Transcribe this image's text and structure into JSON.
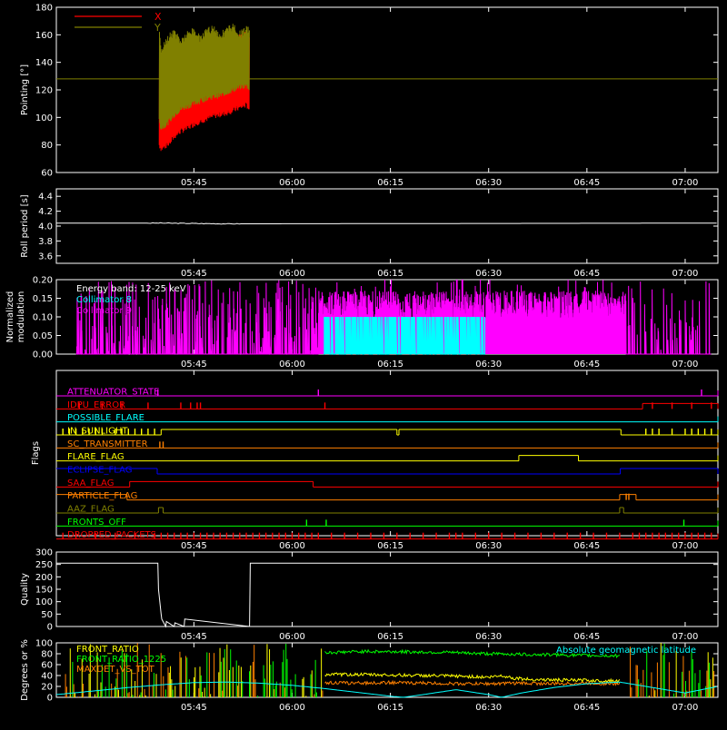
{
  "time_axis": {
    "ticks": [
      "05:45",
      "06:00",
      "06:15",
      "06:30",
      "06:45",
      "07:00"
    ],
    "tick_times_min": [
      345,
      360,
      375,
      390,
      405,
      420
    ],
    "range_min": [
      324,
      425
    ]
  },
  "chart_data": [
    {
      "id": "pointing",
      "type": "line",
      "ylabel": "Pointing [°]",
      "ylim": [
        60,
        180
      ],
      "yticks": [
        "60",
        "80",
        "100",
        "120",
        "140",
        "160",
        "180"
      ],
      "ytick_values": [
        60,
        80,
        100,
        120,
        140,
        160,
        180
      ],
      "legend": [
        {
          "name": "X",
          "color": "#ff0000"
        },
        {
          "name": "Y",
          "color": "#808000"
        }
      ],
      "legend_position": "top-left",
      "reference_line": {
        "value": 128,
        "color": "#808000"
      },
      "series": [
        {
          "name": "X",
          "color": "#ff0000",
          "x_min": [
            339.7,
            340,
            341,
            342,
            343,
            344,
            345,
            346,
            347,
            348,
            349,
            350,
            351,
            352,
            353,
            353.5
          ],
          "y_min": [
            78,
            75,
            78,
            84,
            88,
            90,
            93,
            95,
            97,
            99,
            100,
            101,
            103,
            105,
            107,
            104
          ],
          "y_max": [
            150,
            148,
            150,
            152,
            153,
            150,
            154,
            155,
            156,
            152,
            157,
            158,
            160,
            162,
            163,
            160
          ]
        },
        {
          "name": "Y",
          "color": "#808000",
          "x_min": [
            339.7,
            340,
            341,
            342,
            343,
            344,
            345,
            346,
            347,
            348,
            349,
            350,
            351,
            352,
            353,
            353.5
          ],
          "y_min": [
            95,
            90,
            94,
            100,
            104,
            106,
            108,
            110,
            112,
            113,
            114,
            116,
            118,
            120,
            121,
            119
          ],
          "y_max": [
            170,
            150,
            160,
            165,
            158,
            163,
            166,
            160,
            165,
            168,
            162,
            166,
            169,
            163,
            167,
            165
          ]
        }
      ]
    },
    {
      "id": "roll_period",
      "type": "line",
      "ylabel": "Roll period [s]",
      "ylim": [
        3.5,
        4.5
      ],
      "yticks": [
        "3.6",
        "3.8",
        "4.0",
        "4.2",
        "4.4"
      ],
      "ytick_values": [
        3.6,
        3.8,
        4.0,
        4.2,
        4.4
      ],
      "series": [
        {
          "name": "",
          "color": "#ffffff",
          "x": [
            324,
            340,
            350,
            425
          ],
          "y": [
            4.04,
            4.04,
            4.03,
            4.04
          ]
        }
      ]
    },
    {
      "id": "modulation",
      "type": "line",
      "ylabel": "Normalized modulation",
      "ylim": [
        0,
        0.2
      ],
      "yticks": [
        "0.00",
        "0.05",
        "0.10",
        "0.15",
        "0.20"
      ],
      "ytick_values": [
        0,
        0.05,
        0.1,
        0.15,
        0.2
      ],
      "annotation": "Energy band: 12-25 keV",
      "legend": [
        {
          "name": "Collimator 8",
          "color": "#00ffff"
        },
        {
          "name": "Collimator 9",
          "color": "#ff00ff"
        }
      ],
      "series": [
        {
          "name": "Collimator 8",
          "color": "#00ffff",
          "x_start": 364.8,
          "x_end": 389.5,
          "level": 0.1
        },
        {
          "name": "Collimator 9",
          "color": "#ff00ff",
          "x_start": 327,
          "x_end": 424,
          "level": 0.12
        }
      ]
    },
    {
      "id": "flags",
      "type": "line",
      "ylabel": "Flags",
      "flags": [
        {
          "name": "ATTENUATOR_STATE",
          "color": "#ff00ff",
          "segments": [
            [
              324,
              425,
              0
            ]
          ],
          "spikes": [
            339.5,
            364.0,
            422.5
          ]
        },
        {
          "name": "IDPU_ERROR",
          "color": "#ff0000",
          "segments": [
            [
              324,
              413.5,
              0
            ],
            [
              413.5,
              425,
              1
            ]
          ],
          "spikes": [
            327.5,
            331,
            334,
            338,
            343,
            344.5,
            345.5,
            346,
            365,
            415,
            418,
            421,
            424
          ]
        },
        {
          "name": "POSSIBLE_FLARE",
          "color": "#00ffff",
          "segments": [
            [
              324,
              425,
              0
            ]
          ],
          "spikes": []
        },
        {
          "name": "IN_SUNLIGHT",
          "color": "#ffff00",
          "segments": [
            [
              324,
              340,
              0
            ],
            [
              340,
              376,
              1
            ],
            [
              376,
              376.3,
              0
            ],
            [
              376.3,
              410.2,
              1
            ],
            [
              410.2,
              425,
              0
            ]
          ],
          "spikes": [
            325,
            326,
            327,
            328,
            329,
            330,
            331,
            333,
            334,
            335,
            336,
            337,
            338,
            339,
            414,
            415,
            416,
            418,
            420,
            421,
            422,
            423,
            424
          ]
        },
        {
          "name": "SC_TRANSMITTER",
          "color": "#ff8000",
          "segments": [
            [
              324,
              425,
              0
            ]
          ],
          "spikes": [
            339.8,
            340.3
          ]
        },
        {
          "name": "FLARE_FLAG",
          "color": "#ffff00",
          "segments": [
            [
              324,
              394.6,
              0
            ],
            [
              394.6,
              403.7,
              1
            ],
            [
              403.7,
              425,
              0
            ]
          ],
          "spikes": []
        },
        {
          "name": "ECLIPSE_FLAG",
          "color": "#0000ff",
          "segments": [
            [
              324,
              339.4,
              1
            ],
            [
              339.4,
              410.1,
              0
            ],
            [
              410.1,
              425,
              1
            ]
          ],
          "spikes": []
        },
        {
          "name": "SAA_FLAG",
          "color": "#ff0000",
          "segments": [
            [
              324,
              335.2,
              0
            ],
            [
              335.2,
              363.2,
              1
            ],
            [
              363.2,
              425,
              0
            ]
          ],
          "spikes": []
        },
        {
          "name": "PARTICLE_FLAG",
          "color": "#ff8000",
          "segments": [
            [
              324,
              334.8,
              1
            ],
            [
              334.8,
              410.0,
              0
            ],
            [
              410.0,
              412.5,
              1
            ],
            [
              412.5,
              425,
              0
            ]
          ],
          "spikes": [
            411,
            411.4
          ]
        },
        {
          "name": "AAZ_FLAG",
          "color": "#808000",
          "segments": [
            [
              324,
              339.6,
              0
            ],
            [
              339.6,
              340.3,
              1
            ],
            [
              340.3,
              410.0,
              0
            ],
            [
              410.0,
              410.6,
              1
            ],
            [
              410.6,
              425,
              0
            ]
          ],
          "spikes": []
        },
        {
          "name": "FRONTS_OFF",
          "color": "#00ff00",
          "segments": [
            [
              324,
              425,
              0
            ]
          ],
          "spikes": [
            362.2,
            365.2,
            419.8
          ]
        },
        {
          "name": "DROPPED_PACKETS",
          "color": "#ff0000",
          "segments": [
            [
              324,
              425,
              0
            ]
          ],
          "spikes": [
            325,
            327,
            330,
            333,
            336,
            339,
            340,
            341,
            342,
            343,
            344,
            345,
            346,
            347,
            348,
            349,
            350,
            351,
            352,
            353,
            354,
            355,
            356,
            357,
            358,
            359,
            360,
            361,
            362,
            363,
            364,
            366,
            368,
            370,
            372,
            374,
            376,
            378,
            380,
            382,
            384,
            385,
            386,
            388,
            390,
            392,
            394,
            396,
            398,
            400,
            402,
            404,
            406,
            408,
            410,
            412,
            413,
            414,
            415,
            416,
            417,
            418,
            419,
            420,
            421,
            422,
            423,
            424
          ]
        }
      ]
    },
    {
      "id": "quality",
      "type": "line",
      "ylabel": "Quality",
      "ylim": [
        0,
        300
      ],
      "yticks": [
        "0",
        "50",
        "100",
        "150",
        "200",
        "250",
        "300"
      ],
      "ytick_values": [
        0,
        50,
        100,
        150,
        200,
        250,
        300
      ],
      "series": [
        {
          "name": "",
          "color": "#ffffff",
          "x": [
            324,
            339.5,
            339.6,
            340.0,
            340.1,
            340.7,
            340.8,
            342.0,
            342.1,
            343.5,
            343.6,
            353.5,
            353.6,
            425
          ],
          "y": [
            255,
            255,
            150,
            50,
            30,
            0,
            20,
            0,
            15,
            0,
            30,
            0,
            255,
            255
          ]
        }
      ]
    },
    {
      "id": "ratios",
      "type": "line",
      "ylabel": "Degrees or %",
      "ylim": [
        0,
        100
      ],
      "yticks": [
        "0",
        "20",
        "40",
        "60",
        "80",
        "100"
      ],
      "ytick_values": [
        0,
        20,
        40,
        60,
        80,
        100
      ],
      "legend": [
        {
          "name": "FRONT_RATIO",
          "color": "#ffff00"
        },
        {
          "name": "FRONT_RATIO_1225",
          "color": "#00ff00"
        },
        {
          "name": "MAXDET_VS_TOT",
          "color": "#ff8000"
        }
      ],
      "annotation": "Absolute geomagnetic latitude",
      "annotation_color": "#00ffff",
      "series": [
        {
          "name": "FRONT_RATIO",
          "color": "#ffff00",
          "x": [
            365,
            370,
            375,
            380,
            385,
            390,
            392,
            394,
            396,
            400,
            405,
            410
          ],
          "y": [
            42,
            42,
            41,
            40,
            39,
            37,
            40,
            35,
            33,
            32,
            31,
            30
          ]
        },
        {
          "name": "FRONT_RATIO_1225",
          "color": "#00ff00",
          "x": [
            365,
            370,
            375,
            380,
            385,
            390,
            395,
            400,
            405,
            410
          ],
          "y": [
            82,
            84,
            84,
            83,
            82,
            80,
            79,
            78,
            77,
            76
          ]
        },
        {
          "name": "MAXDET_VS_TOT",
          "color": "#ff8000",
          "x": [
            365,
            370,
            375,
            380,
            385,
            390,
            395,
            400,
            405,
            410
          ],
          "y": [
            27,
            26,
            27,
            26,
            25,
            25,
            26,
            25,
            26,
            25
          ]
        },
        {
          "name": "Absolute geomagnetic latitude",
          "color": "#00ffff",
          "x": [
            324,
            330,
            335,
            340,
            345,
            350,
            355,
            360,
            365,
            370,
            375,
            377,
            380,
            385,
            390,
            392,
            395,
            400,
            405,
            410,
            415,
            420,
            425
          ],
          "y": [
            5,
            12,
            18,
            23,
            27,
            28,
            26,
            22,
            16,
            9,
            2,
            0,
            5,
            14,
            5,
            0,
            8,
            18,
            25,
            28,
            18,
            8,
            20
          ]
        }
      ]
    }
  ]
}
